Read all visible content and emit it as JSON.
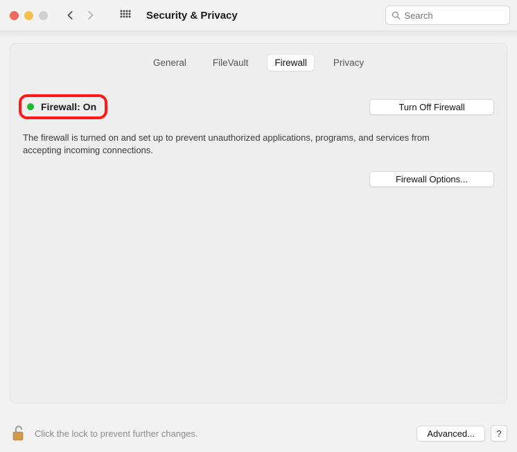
{
  "header": {
    "title": "Security & Privacy",
    "search_placeholder": "Search"
  },
  "tabs": {
    "general": "General",
    "filevault": "FileVault",
    "firewall": "Firewall",
    "privacy": "Privacy",
    "active": "firewall"
  },
  "firewall": {
    "status_label": "Firewall: On",
    "status_color": "#1fba2c",
    "turn_off_label": "Turn Off Firewall",
    "description": "The firewall is turned on and set up to prevent unauthorized applications, programs, and services from accepting incoming connections.",
    "options_label": "Firewall Options..."
  },
  "footer": {
    "lock_label": "Click the lock to prevent further changes.",
    "advanced_label": "Advanced...",
    "help_label": "?"
  }
}
